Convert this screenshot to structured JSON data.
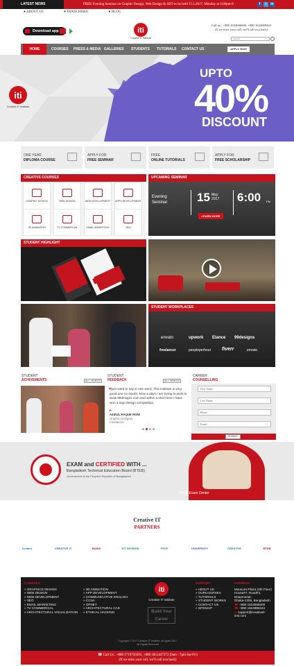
{
  "topbar": {
    "latest_label": "LATEST NEWS",
    "ticker": "FREE Evening Seminar on Graphic Design, Web Design & SEO to be held 15.5.2017, Monday at 6:00pm-8",
    "social": [
      "f",
      "t",
      "in"
    ]
  },
  "toplinks": [
    "ABOUT US",
    "FRANCHISEE",
    "BLOG"
  ],
  "header": {
    "download_label": "Download app",
    "logo_caption": "Creative IT Institute",
    "call_line": "Call us : +880 1624666000, +880 1624888444",
    "call_sub": "(If we miss your call, we'll call you back)",
    "search_placeholder": "search"
  },
  "nav": {
    "items": [
      "HOME",
      "COURSES",
      "PRESS & MEDIA",
      "GALLERIES",
      "STUDENTS",
      "TUTORIALS",
      "CONTACT US"
    ],
    "apply_label": "APPLY NOW"
  },
  "hero": {
    "brand": "Creative IT Institute",
    "upto": "UPTO",
    "percent": "40%",
    "discount": "DISCOUNT",
    "colors": {
      "panel": "#6b5fc7",
      "accent": "#d0111b"
    }
  },
  "info_boxes": [
    {
      "line1": "ONE YEAR",
      "line2": "DIPLOMA COURSE"
    },
    {
      "line1": "APPLY FOR",
      "line2": "FREE SEMINAR"
    },
    {
      "line1": "FREE",
      "line2": "ONLINE TUTORIALS"
    },
    {
      "line1": "APPLY FOR",
      "line2": "FREE SCHOLARSHIP"
    }
  ],
  "creative_courses": {
    "title": "CREATIVE COURSES",
    "items": [
      "GRAPHIC DESIGN",
      "WEB DESIGN",
      "WEB DEVELOPMENT",
      "APPS DEVELOPMENT",
      "3D ANIMATION",
      "TV COMMERCIAL",
      "EMAIL MARKETING",
      "SEO"
    ]
  },
  "seminar": {
    "title": "UPCAMING SEMINAR",
    "label1": "Evening",
    "label2": "Seminar",
    "day": "15",
    "month": "May",
    "year": "2017",
    "time": "6:00",
    "time_suffix": "PM",
    "learn_more": "LEARN MORE"
  },
  "highlight": {
    "title": "STUDENT HIGHLIGHT"
  },
  "workplaces": {
    "title": "STUDENT WORKPLACES",
    "brands": [
      "envato",
      "upwork",
      "Elance",
      "99designs",
      "freelancer",
      "peopleperhour",
      "fiverr",
      "envato"
    ]
  },
  "achievements": {
    "label": "STUDENT",
    "title": "ACHIVEMENTS",
    "btn": "ALL VIDEOS"
  },
  "feedback": {
    "label": "STUDENT",
    "title": "FEEDBACK",
    "btn": "ALL VIDEOS",
    "quote": "I just want to say in one word, This institute is very good one no Doubt. Now a days I am trying to work in www.99designs.com and within a short time I have won a logo design competition.",
    "name": "AZIZUL HAQUE RONI",
    "role1": "Graphic Designer",
    "role2": "Freelancer"
  },
  "counselling": {
    "label": "CAREER",
    "title": "COUNSELLING",
    "fields": [
      "First Name",
      "Last Name",
      "Phone",
      "Email"
    ],
    "submit": "SUBMIT"
  },
  "exam": {
    "line1": "EXAM and",
    "certified": "CERTIFIED",
    "line1_end": "WITH ...",
    "board": "Bangladesh Technical Education Board (BTEB)",
    "gov": "Government of the People's Republic of Bangladesh",
    "center": "BTEB Exam Center"
  },
  "partners": {
    "title": "Creative IT",
    "subtitle": "PARTNERS",
    "names": [
      "Iceland",
      "CREATIVE IT",
      "BASIS",
      "ICT DIVISION",
      "PEDP",
      "UNIVERSITY",
      "CREATIVE",
      "BTEB"
    ]
  },
  "footer": {
    "courses_title": "COURSES",
    "courses_a": [
      "GRAPHICS DESIGN",
      "WEB DESIGN",
      "WEB DEVELOPMENT",
      "SEO",
      "EMAIL MARKETING",
      "TV COMMERCIAL",
      "ARCHITECTURAL VISUALIZATION"
    ],
    "courses_b": [
      "3D ANIMATION",
      "APP DEVELOPMENT",
      "COMMUNICATIVE ENGLISH",
      "CCNA",
      "OPNET",
      "ARCHITECTURAL CAD",
      "ETHICAL HACKING"
    ],
    "logo_caption": "Creative IT Institute",
    "build_text": "Build Your Career",
    "support_title": "SUPPORT",
    "support": [
      "ABOUT US",
      "OURCOURSES",
      "TUTORIALS",
      "STUDENT WORKS",
      "CONTACT US",
      "SITEMAP"
    ],
    "address_title": "ADDRESS",
    "address": [
      "Mousumi Plaza (4th Floor)",
      "House#7, Road#4,",
      "Dhanmondi,",
      "Dhaka-1205, Bangladesh",
      "+880 1624666000",
      "+880 1624888444",
      "support@creativeit-inst.com"
    ],
    "copyright": "Copyright © 2017 Creative IT Institute, all rights 2017.",
    "rights": "All Rights Reserved",
    "call_bar": "Call Us : +880 1719750301, +880 1851447272 (9am - 7pm Sat-Fri)",
    "call_bar_sub": "(If we miss your call, we'll call you back)"
  }
}
